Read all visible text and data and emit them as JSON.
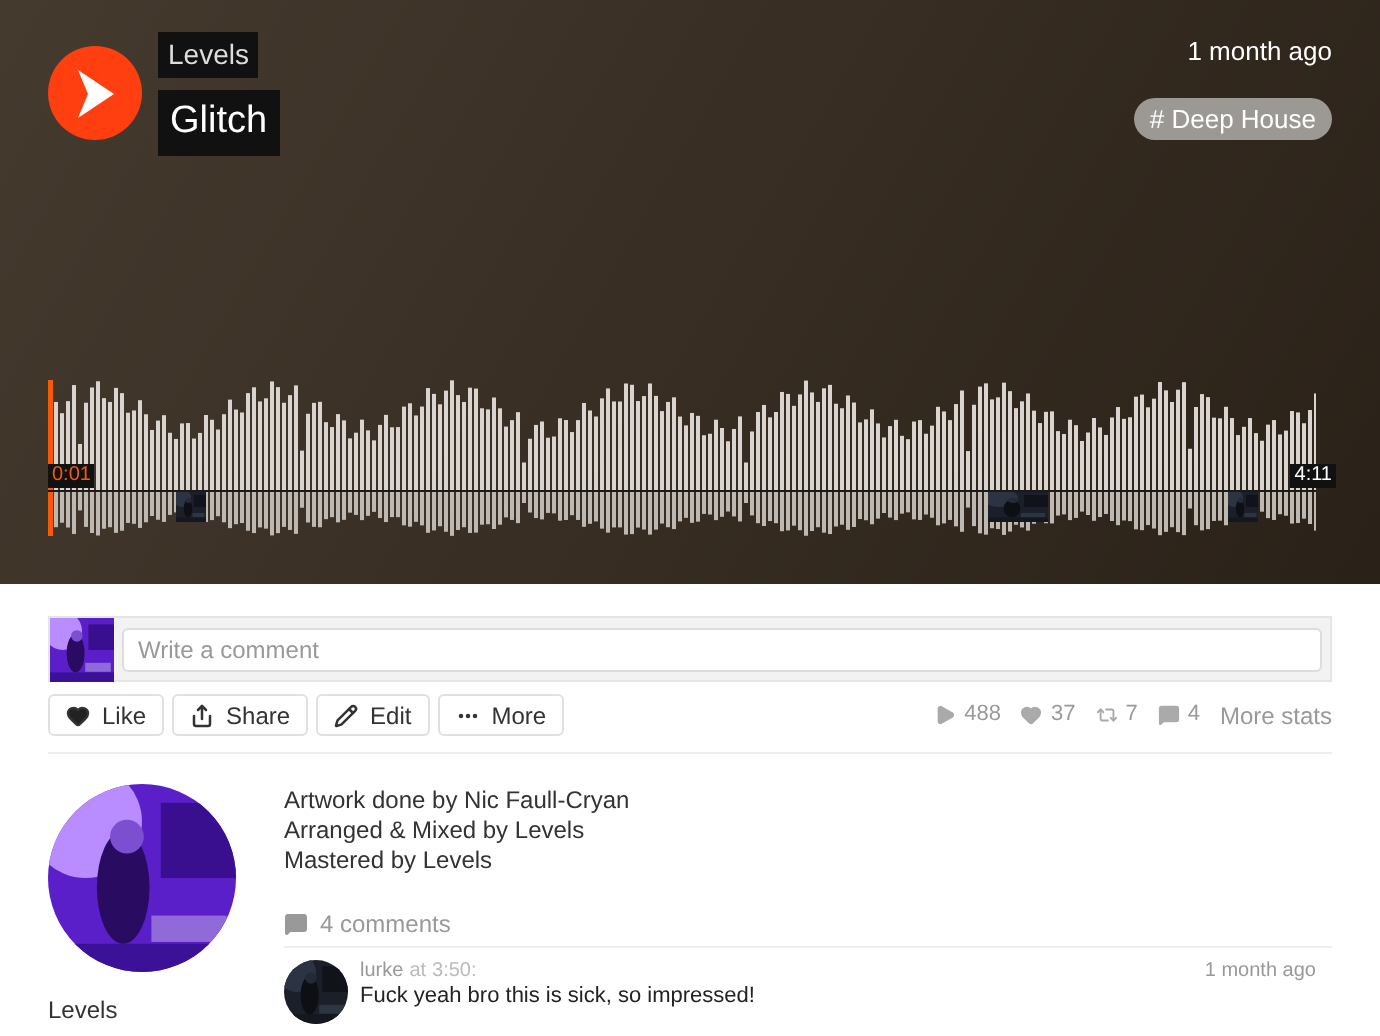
{
  "track": {
    "artist": "Levels",
    "title": "Glitch",
    "posted": "1 month ago",
    "tag": "# Deep House"
  },
  "player": {
    "level": 0.004,
    "elapsed": "0:01",
    "duration": "4:11"
  },
  "comment_box": {
    "placeholder": "Write a comment"
  },
  "actions": [
    {
      "label": "Like",
      "kind": "like"
    },
    {
      "label": "Share",
      "kind": "share"
    },
    {
      "label": "Edit",
      "kind": "edit"
    },
    {
      "label": "More",
      "kind": "more"
    }
  ],
  "stats": [
    {
      "kind": "plays",
      "value": "488"
    },
    {
      "kind": "likes",
      "value": "37"
    },
    {
      "kind": "reposts",
      "value": "7"
    },
    {
      "kind": "comments",
      "value": "4"
    }
  ],
  "more_stats": "More stats",
  "uploader": {
    "name": "Levels"
  },
  "description": [
    "Artwork done by Nic Faull-Cryan",
    "Arranged & Mixed by Levels",
    "Mastered by Levels"
  ],
  "comments_count": "4 comments",
  "comments": [
    {
      "user": "lurke",
      "at": "at",
      "time": "3:50:",
      "text": "Fuck yeah bro this is sick, so impressed!",
      "posted": "1 month ago"
    }
  ]
}
